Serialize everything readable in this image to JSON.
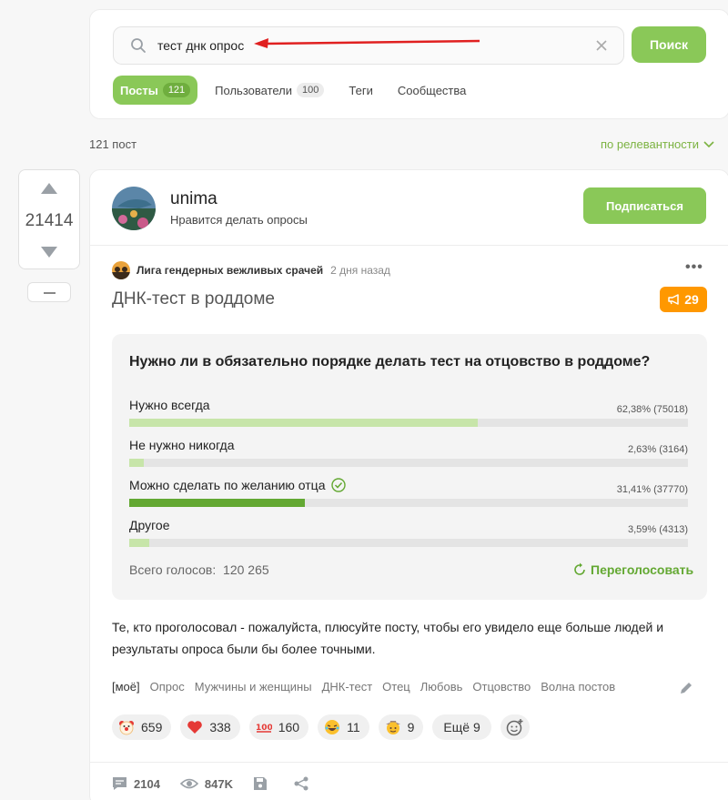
{
  "search": {
    "query": "тест днк опрос",
    "button_label": "Поиск"
  },
  "tabs": [
    {
      "label": "Посты",
      "count": "121"
    },
    {
      "label": "Пользователи",
      "count": "100"
    },
    {
      "label": "Теги",
      "count": ""
    },
    {
      "label": "Сообщества",
      "count": ""
    }
  ],
  "results": {
    "count_label": "121 пост",
    "sort_label": "по релевантности"
  },
  "vote": {
    "rating": "21414"
  },
  "author": {
    "name": "unima",
    "description": "Нравится делать опросы",
    "subscribe_label": "Подписаться"
  },
  "post": {
    "community": "Лига гендерных вежливых срачей",
    "time": "2 дня назад",
    "title": "ДНК-тест в роддоме",
    "hot_count": "29",
    "text": "Те, кто проголосовал - пожалуйста, плюсуйте посту, чтобы его увидело еще больше людей и результаты опроса были бы более точными."
  },
  "poll": {
    "question": "Нужно ли в обязательно порядке делать тест на отцовство в роддоме?",
    "options": [
      {
        "label": "Нужно всегда",
        "result": "62,38% (75018)",
        "fraction": 0.6238,
        "voted": false
      },
      {
        "label": "Не нужно никогда",
        "result": "2,63% (3164)",
        "fraction": 0.0263,
        "voted": false
      },
      {
        "label": "Можно сделать по желанию отца",
        "result": "31,41% (37770)",
        "fraction": 0.3141,
        "voted": true
      },
      {
        "label": "Другое",
        "result": "3,59% (4313)",
        "fraction": 0.0359,
        "voted": false
      }
    ],
    "total_label": "Всего голосов:",
    "total_value": "120 265",
    "revote_label": "Переголосовать"
  },
  "tags": [
    "[моё]",
    "Опрос",
    "Мужчины и женщины",
    "ДНК-тест",
    "Отец",
    "Любовь",
    "Отцовство",
    "Волна постов"
  ],
  "reactions": [
    {
      "icon": "clown-emoji",
      "count": "659"
    },
    {
      "icon": "heart-emoji",
      "count": "338"
    },
    {
      "icon": "hundred-emoji",
      "count": "160"
    },
    {
      "icon": "laughing-emoji",
      "count": "11"
    },
    {
      "icon": "cowboy-emoji",
      "count": "9"
    }
  ],
  "more_reactions_label": "Ещё 9",
  "footer": {
    "comments": "2104",
    "views": "847K"
  },
  "colors": {
    "accent": "#8ac858",
    "hot": "#ff9800",
    "link": "#7cb342"
  }
}
